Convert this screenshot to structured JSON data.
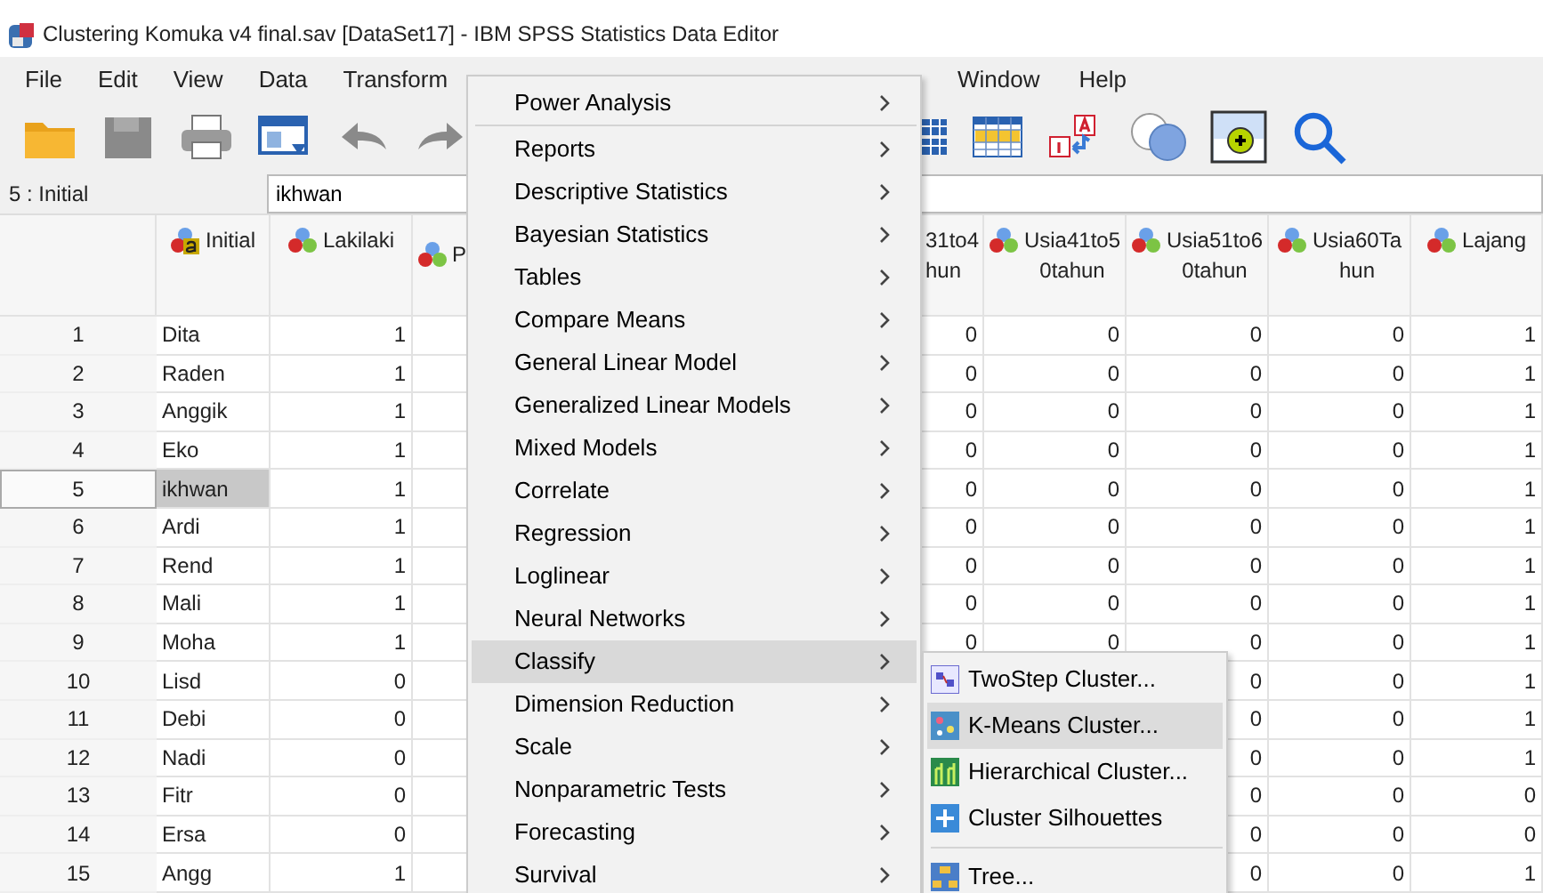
{
  "window": {
    "title": "Clustering Komuka v4 final.sav [DataSet17] - IBM SPSS Statistics Data Editor"
  },
  "menubar": {
    "left": [
      "File",
      "Edit",
      "View",
      "Data",
      "Transform"
    ],
    "right": [
      "Window",
      "Help"
    ]
  },
  "toolbar": {
    "save_disabled": true
  },
  "cell_editor": {
    "label": "5 : Initial",
    "value": "ikhwan"
  },
  "grid": {
    "rows": [
      {
        "number": "1",
        "selected": false
      },
      {
        "number": "2",
        "selected": false
      },
      {
        "number": "3",
        "selected": false
      },
      {
        "number": "4",
        "selected": false
      },
      {
        "number": "5",
        "selected": true
      },
      {
        "number": "6",
        "selected": false
      },
      {
        "number": "7",
        "selected": false
      },
      {
        "number": "8",
        "selected": false
      },
      {
        "number": "9",
        "selected": false
      },
      {
        "number": "10",
        "selected": false
      },
      {
        "number": "11",
        "selected": false
      },
      {
        "number": "12",
        "selected": false
      },
      {
        "number": "13",
        "selected": false
      },
      {
        "number": "14",
        "selected": false
      },
      {
        "number": "15",
        "selected": false
      }
    ],
    "columns": [
      {
        "kind": "string",
        "lines": [
          "Initial"
        ],
        "values": [
          "Dita",
          "Raden",
          "Anggik",
          "Eko",
          "ikhwan",
          "Ardi",
          "Rend",
          "Mali",
          "Moha",
          "Lisd",
          "Debi",
          "Nadi",
          "Fitr",
          "Ersa",
          "Angg"
        ]
      },
      {
        "kind": "nominal",
        "lines": [
          "Lakilaki"
        ],
        "values": [
          "1",
          "1",
          "1",
          "1",
          "1",
          "1",
          "1",
          "1",
          "1",
          "0",
          "0",
          "0",
          "0",
          "0",
          "1"
        ]
      },
      {
        "kind": "nominal_left",
        "lines": [
          "P"
        ]
      },
      {
        "kind": "cut",
        "lines": [
          "31to4",
          "hun"
        ],
        "values": [
          "0",
          "0",
          "0",
          "0",
          "0",
          "0",
          "0",
          "0",
          "0"
        ]
      },
      {
        "kind": "nominal",
        "lines": [
          "Usia41to5",
          "0tahun"
        ],
        "values": [
          "0",
          "0",
          "0",
          "0",
          "0",
          "0",
          "0",
          "0",
          "0"
        ]
      },
      {
        "kind": "nominal",
        "lines": [
          "Usia51to6",
          "0tahun"
        ],
        "values": [
          "0",
          "0",
          "0",
          "0",
          "0",
          "0",
          "0",
          "0",
          "0",
          "0",
          "0",
          "0",
          "0",
          "0",
          "0"
        ]
      },
      {
        "kind": "nominal",
        "lines": [
          "Usia60Ta",
          "hun"
        ],
        "values": [
          "0",
          "0",
          "0",
          "0",
          "0",
          "0",
          "0",
          "0",
          "0",
          "0",
          "0",
          "0",
          "0",
          "0",
          "0"
        ]
      },
      {
        "kind": "nominal",
        "lines": [
          "Lajang"
        ],
        "values": [
          "1",
          "1",
          "1",
          "1",
          "1",
          "1",
          "1",
          "1",
          "1",
          "1",
          "1",
          "1",
          "0",
          "0",
          "1"
        ]
      }
    ]
  },
  "analyze_menu": {
    "items": [
      {
        "kind": "item",
        "label": "Power Analysis",
        "submenu": true,
        "selected": false
      },
      {
        "kind": "separator"
      },
      {
        "kind": "item",
        "label": "Reports",
        "submenu": true,
        "selected": false
      },
      {
        "kind": "item",
        "label": "Descriptive Statistics",
        "submenu": true,
        "selected": false
      },
      {
        "kind": "item",
        "label": "Bayesian Statistics",
        "submenu": true,
        "selected": false
      },
      {
        "kind": "item",
        "label": "Tables",
        "submenu": true,
        "selected": false
      },
      {
        "kind": "item",
        "label": "Compare Means",
        "submenu": true,
        "selected": false
      },
      {
        "kind": "item",
        "label": "General Linear Model",
        "submenu": true,
        "selected": false
      },
      {
        "kind": "item",
        "label": "Generalized Linear Models",
        "submenu": true,
        "selected": false
      },
      {
        "kind": "item",
        "label": "Mixed Models",
        "submenu": true,
        "selected": false
      },
      {
        "kind": "item",
        "label": "Correlate",
        "submenu": true,
        "selected": false
      },
      {
        "kind": "item",
        "label": "Regression",
        "submenu": true,
        "selected": false
      },
      {
        "kind": "item",
        "label": "Loglinear",
        "submenu": true,
        "selected": false
      },
      {
        "kind": "item",
        "label": "Neural Networks",
        "submenu": true,
        "selected": false
      },
      {
        "kind": "item",
        "label": "Classify",
        "submenu": true,
        "selected": true
      },
      {
        "kind": "item",
        "label": "Dimension Reduction",
        "submenu": true,
        "selected": false
      },
      {
        "kind": "item",
        "label": "Scale",
        "submenu": true,
        "selected": false
      },
      {
        "kind": "item",
        "label": "Nonparametric Tests",
        "submenu": true,
        "selected": false
      },
      {
        "kind": "item",
        "label": "Forecasting",
        "submenu": true,
        "selected": false
      },
      {
        "kind": "item",
        "label": "Survival",
        "submenu": true,
        "selected": false
      }
    ]
  },
  "classify_submenu": {
    "items": [
      {
        "kind": "item",
        "label": "TwoStep Cluster...",
        "selected": false
      },
      {
        "kind": "item",
        "label": "K-Means Cluster...",
        "selected": true
      },
      {
        "kind": "item",
        "label": "Hierarchical Cluster...",
        "selected": false
      },
      {
        "kind": "item",
        "label": "Cluster Silhouettes",
        "selected": false
      },
      {
        "kind": "separator"
      },
      {
        "kind": "item",
        "label": "Tree...",
        "selected": false
      }
    ]
  }
}
